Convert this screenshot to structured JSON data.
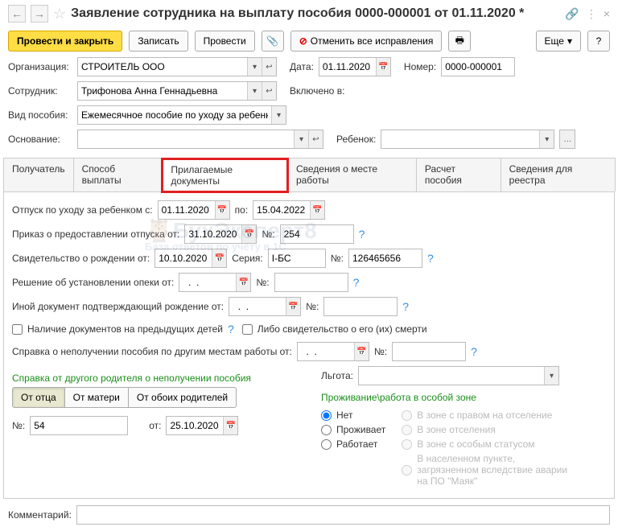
{
  "header": {
    "title": "Заявление сотрудника на выплату пособия 0000-000001 от 01.11.2020 *"
  },
  "toolbar": {
    "post_close": "Провести и закрыть",
    "save": "Записать",
    "post": "Провести",
    "cancel_fixes": "Отменить все исправления",
    "more": "Еще"
  },
  "main": {
    "org_label": "Организация:",
    "org_value": "СТРОИТЕЛЬ ООО",
    "date_label": "Дата:",
    "date_value": "01.11.2020",
    "num_label": "Номер:",
    "num_value": "0000-000001",
    "emp_label": "Сотрудник:",
    "emp_value": "Трифонова Анна Геннадьевна",
    "included_label": "Включено в:",
    "benefit_label": "Вид пособия:",
    "benefit_value": "Ежемесячное пособие по уходу за ребенком",
    "basis_label": "Основание:",
    "child_label": "Ребенок:"
  },
  "tabs": [
    "Получатель",
    "Способ выплаты",
    "Прилагаемые документы",
    "Сведения о месте работы",
    "Расчет пособия",
    "Сведения для реестра"
  ],
  "docs": {
    "leave_label": "Отпуск по уходу за ребенком с:",
    "leave_from": "01.11.2020",
    "leave_to_label": "по:",
    "leave_to": "15.04.2022",
    "order_label": "Приказ о предоставлении отпуска от:",
    "order_date": "31.10.2020",
    "order_num_label": "№:",
    "order_num": "254",
    "birth_cert_label": "Свидетельство о рождении от:",
    "birth_cert_date": "10.10.2020",
    "birth_cert_series_label": "Серия:",
    "birth_cert_series": "I-БС",
    "birth_cert_num_label": "№:",
    "birth_cert_num": "126465656",
    "guardianship_label": "Решение об установлении опеки от:",
    "guardianship_date": "  .  .    ",
    "guardianship_num_label": "№:",
    "otherdoc_label": "Иной документ подтверждающий рождение от:",
    "otherdoc_date": "  .  .    ",
    "otherdoc_num_label": "№:",
    "prev_children": "Наличие документов на предыдущих детей",
    "death_cert": "Либо свидетельство о его (их) смерти",
    "noreceipt_label": "Справка о неполучении пособия по другим местам работы от:",
    "noreceipt_date": "  .  .    ",
    "noreceipt_num_label": "№:",
    "parent_title": "Справка от другого родителя о неполучении пособия",
    "from_father": "От отца",
    "from_mother": "От матери",
    "from_both": "От обоих родителей",
    "parent_num_label": "№:",
    "parent_num": "54",
    "parent_date_label": "от:",
    "parent_date": "25.10.2020",
    "privilege_label": "Льгота:",
    "zone_title": "Проживание\\работа в особой зоне",
    "zone_none": "Нет",
    "zone_resettle_right": "В зоне с правом на отселение",
    "zone_lives": "Проживает",
    "zone_resettle": "В зоне отселения",
    "zone_works": "Работает",
    "zone_special": "В зоне с особым статусом",
    "zone_mayak": "В населенном пункте, загрязненном вследствие аварии на ПО \"Маяк\""
  },
  "footer": {
    "comment_label": "Комментарий:"
  },
  "watermark": {
    "main": "БухЭксперт8",
    "sub": "База ответов по учёту в 1С"
  }
}
